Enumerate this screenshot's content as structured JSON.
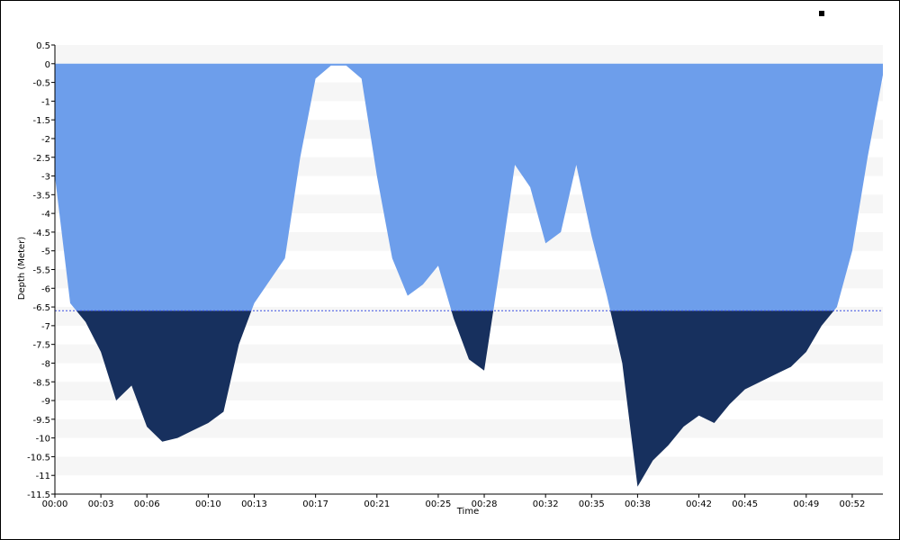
{
  "chart_data": {
    "type": "area",
    "title": "",
    "xlabel": "Time",
    "ylabel": "Depth (Meter)",
    "x_unit": "mm:ss",
    "ylim": [
      -11.5,
      0.5
    ],
    "xlim": [
      "00:00",
      "00:54"
    ],
    "x_ticks": [
      "00:00",
      "00:03",
      "00:06",
      "00:10",
      "00:13",
      "00:17",
      "00:21",
      "00:25",
      "00:28",
      "00:32",
      "00:35",
      "00:38",
      "00:42",
      "00:45",
      "00:49",
      "00:52"
    ],
    "y_ticks": [
      "0.5",
      "0",
      "-0.5",
      "-1",
      "-1.5",
      "-2",
      "-2.5",
      "-3",
      "-3.5",
      "-4",
      "-4.5",
      "-5",
      "-5.5",
      "-6",
      "-6.5",
      "-7",
      "-7.5",
      "-8",
      "-8.5",
      "-9",
      "-9.5",
      "-10",
      "-10.5",
      "-11",
      "-11.5"
    ],
    "threshold": -6.6,
    "grid": "alternating horizontal bands",
    "legend": "top-right",
    "colors": {
      "above_threshold": "#6d9eeb",
      "below_threshold": "#17305e",
      "threshold_line": "#3a4fe0",
      "band": "#f6f6f6"
    },
    "series": [
      {
        "x": [
          "00:00",
          "00:01",
          "00:02",
          "00:03",
          "00:04",
          "00:05",
          "00:06",
          "00:07",
          "00:08",
          "00:09",
          "00:10",
          "00:11",
          "00:12",
          "00:13",
          "00:14",
          "00:15",
          "00:16",
          "00:17",
          "00:18",
          "00:19",
          "00:20",
          "00:21",
          "00:22",
          "00:23",
          "00:24",
          "00:25",
          "00:26",
          "00:27",
          "00:28",
          "00:29",
          "00:30",
          "00:31",
          "00:32",
          "00:33",
          "00:34",
          "00:35",
          "00:36",
          "00:37",
          "00:38",
          "00:39",
          "00:40",
          "00:41",
          "00:42",
          "00:43",
          "00:44",
          "00:45",
          "00:46",
          "00:47",
          "00:48",
          "00:49",
          "00:50",
          "00:51",
          "00:52",
          "00:53",
          "00:54"
        ],
        "y": [
          -3.0,
          -6.4,
          -6.9,
          -7.7,
          -9.0,
          -8.6,
          -9.7,
          -10.1,
          -10.0,
          -9.8,
          -9.6,
          -9.3,
          -7.5,
          -6.4,
          -5.8,
          -5.2,
          -2.5,
          -0.4,
          -0.05,
          -0.05,
          -0.4,
          -3.0,
          -5.2,
          -6.2,
          -5.9,
          -5.4,
          -6.8,
          -7.9,
          -8.2,
          -5.5,
          -2.7,
          -3.3,
          -4.8,
          -4.5,
          -2.7,
          -4.6,
          -6.2,
          -8.0,
          -11.3,
          -10.6,
          -10.2,
          -9.7,
          -9.4,
          -9.6,
          -9.1,
          -8.7,
          -8.5,
          -8.3,
          -8.1,
          -7.7,
          -7.0,
          -6.5,
          -5.0,
          -2.5,
          -0.3
        ]
      }
    ]
  }
}
